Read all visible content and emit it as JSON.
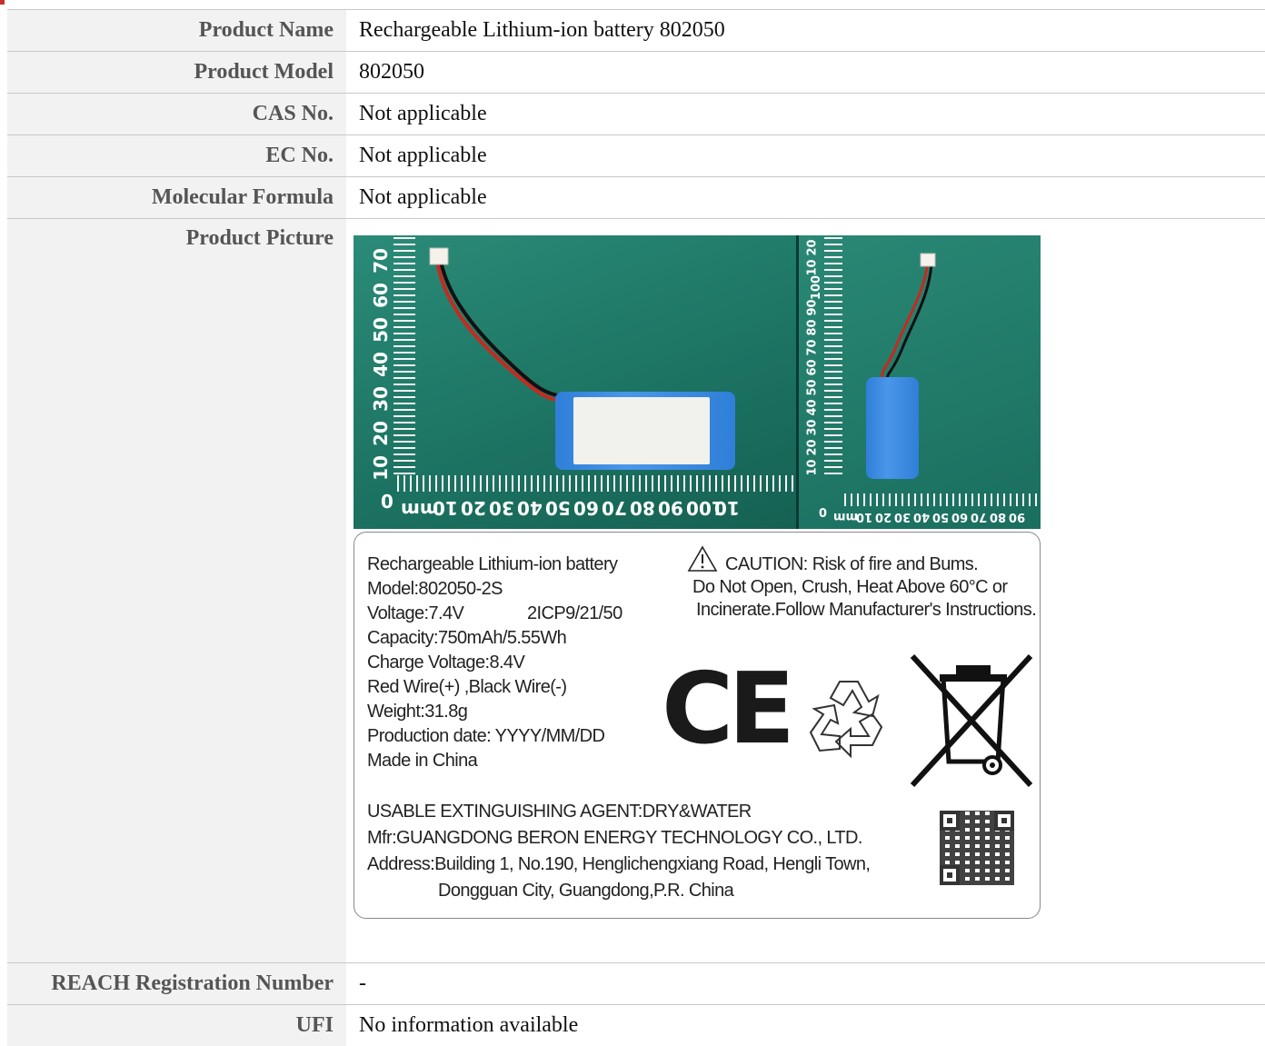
{
  "rows": {
    "product_name": {
      "label": "Product Name",
      "value": "Rechargeable Lithium-ion battery 802050"
    },
    "product_model": {
      "label": "Product Model",
      "value": "802050"
    },
    "cas_no": {
      "label": "CAS No.",
      "value": "Not applicable"
    },
    "ec_no": {
      "label": "EC No.",
      "value": "Not applicable"
    },
    "molecular_formula": {
      "label": "Molecular Formula",
      "value": "Not applicable"
    },
    "product_picture": {
      "label": "Product Picture"
    },
    "reach": {
      "label": "REACH Registration Number",
      "value": "-"
    },
    "ufi": {
      "label": "UFI",
      "value": "No information available"
    }
  },
  "photo": {
    "ruler_left": [
      "70",
      "60",
      "50",
      "40",
      "30",
      "20",
      "10"
    ],
    "ruler_bottom_left": [
      "0",
      "mm",
      "10",
      "20",
      "30",
      "40",
      "50",
      "60",
      "70",
      "80",
      "90",
      "100",
      "10"
    ],
    "ruler_right": [
      "20",
      "10",
      "100",
      "90",
      "80",
      "70",
      "60",
      "50",
      "40",
      "30",
      "20",
      "10"
    ],
    "ruler_bottom_right": [
      "0",
      "mm",
      "10",
      "20",
      "30",
      "40",
      "50",
      "60",
      "70",
      "80",
      "90"
    ]
  },
  "battery_label": {
    "left_lines": [
      "Rechargeable Lithium-ion battery",
      "Model:802050-2S",
      "Voltage:7.4V",
      "Capacity:750mAh/5.55Wh",
      "Charge Voltage:8.4V",
      "Red Wire(+) ,Black Wire(-)",
      "Weight:31.8g",
      "Production date: YYYY/MM/DD",
      "Made in China"
    ],
    "cell_code": "2ICP9/21/50",
    "caution_lines": [
      "CAUTION: Risk of fire and Bums.",
      "Do Not Open, Crush, Heat Above 60°C or",
      "Incinerate.Follow Manufacturer's Instructions."
    ],
    "ce_mark": "CE",
    "bottom_lines": [
      "USABLE EXTINGUISHING AGENT:DRY&WATER",
      "Mfr:GUANGDONG BERON ENERGY TECHNOLOGY CO., LTD.",
      "Address:Building 1, No.190, Henglichengxiang Road, Hengli Town,",
      "Dongguan City, Guangdong,P.R. China"
    ]
  }
}
